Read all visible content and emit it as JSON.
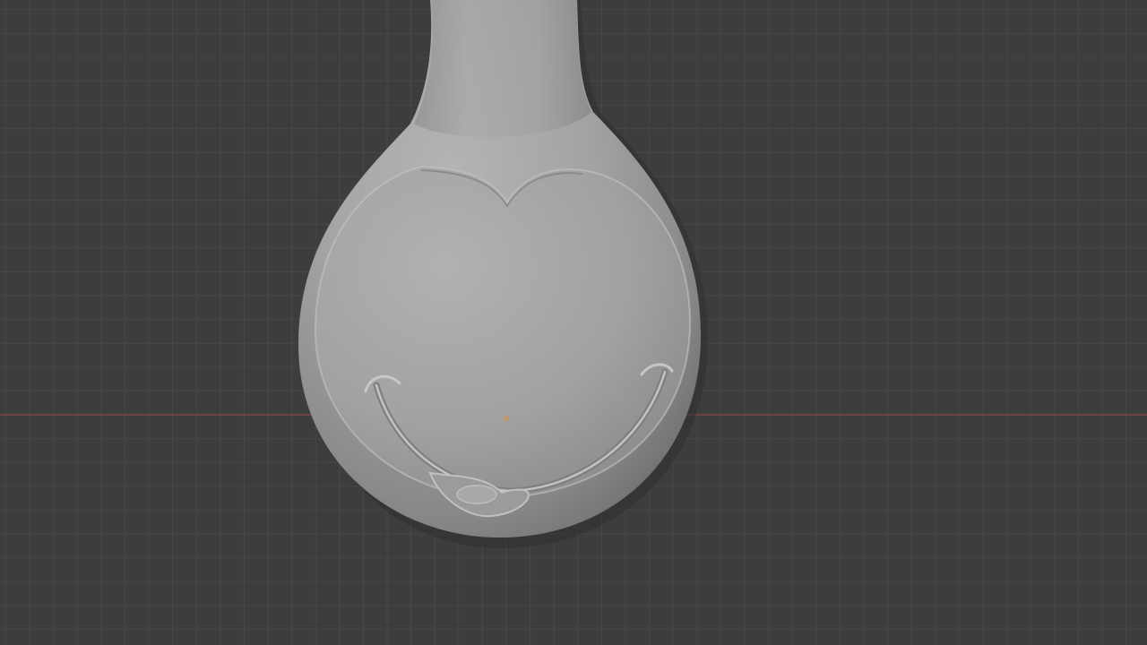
{
  "viewport": {
    "mode": "sculpt",
    "background_color": "#3d3d3d",
    "grid_color_minor": "#474747",
    "grid_color_major": "#4b4b4b",
    "x_axis_color": "#a34b4b",
    "origin_color": "#e08a3a"
  },
  "model": {
    "name_icon": "sculpted-face-mesh",
    "material_color": "#a8a9a9",
    "features": [
      "neck",
      "head",
      "heart-shaped-brow-line",
      "smile",
      "tongue"
    ]
  }
}
